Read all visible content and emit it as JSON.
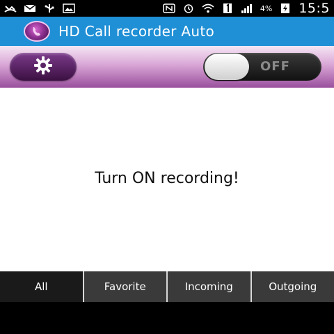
{
  "status_bar": {
    "icons_left": [
      "missed-call-icon",
      "mail-icon",
      "usb-icon",
      "image-icon"
    ],
    "icons_right": [
      "nfc-icon",
      "alarm-icon",
      "wifi-icon",
      "sim-1-icon",
      "signal-icon"
    ],
    "battery_percent": "4%",
    "time": "15:5"
  },
  "title_bar": {
    "title": "HD Call recorder Auto"
  },
  "control_header": {
    "toggle_label": "OFF"
  },
  "main": {
    "message": "Turn ON recording!"
  },
  "tabs": [
    {
      "label": "All",
      "active": true
    },
    {
      "label": "Favorite",
      "active": false
    },
    {
      "label": "Incoming",
      "active": false
    },
    {
      "label": "Outgoing",
      "active": false
    }
  ],
  "colors": {
    "title_bar": "#1f8fd6",
    "accent_purple": "#7b3a8a",
    "tab_bg": "#3a3a3a",
    "tab_active": "#1a1a1a"
  }
}
